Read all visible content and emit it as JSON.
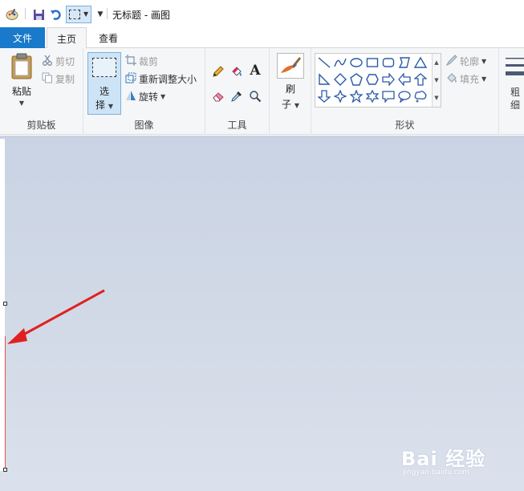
{
  "titlebar": {
    "title": "无标题 - 画图"
  },
  "tabs": {
    "file": "文件",
    "home": "主页",
    "view": "查看"
  },
  "clipboard": {
    "paste": "粘贴",
    "cut": "剪切",
    "copy": "复制",
    "label": "剪贴板"
  },
  "image": {
    "select_line1": "选",
    "select_line2": "择",
    "crop": "裁剪",
    "resize": "重新调整大小",
    "rotate": "旋转",
    "label": "图像"
  },
  "tools": {
    "text_glyph": "A",
    "label": "工具"
  },
  "brushes": {
    "line1": "刷",
    "line2": "子"
  },
  "shapes": {
    "outline": "轮廓",
    "fill": "填充",
    "label": "形状"
  },
  "size": {
    "line1": "粗",
    "line2": "细"
  },
  "watermark": {
    "text": "Bai 经验",
    "sub": "jingyan.baidu.com"
  },
  "colors": {
    "file_tab": "#1979ca",
    "ribbon": "#f5f6f7",
    "arrow": "#e02020",
    "canvas_bg": "#d0d8e6"
  }
}
